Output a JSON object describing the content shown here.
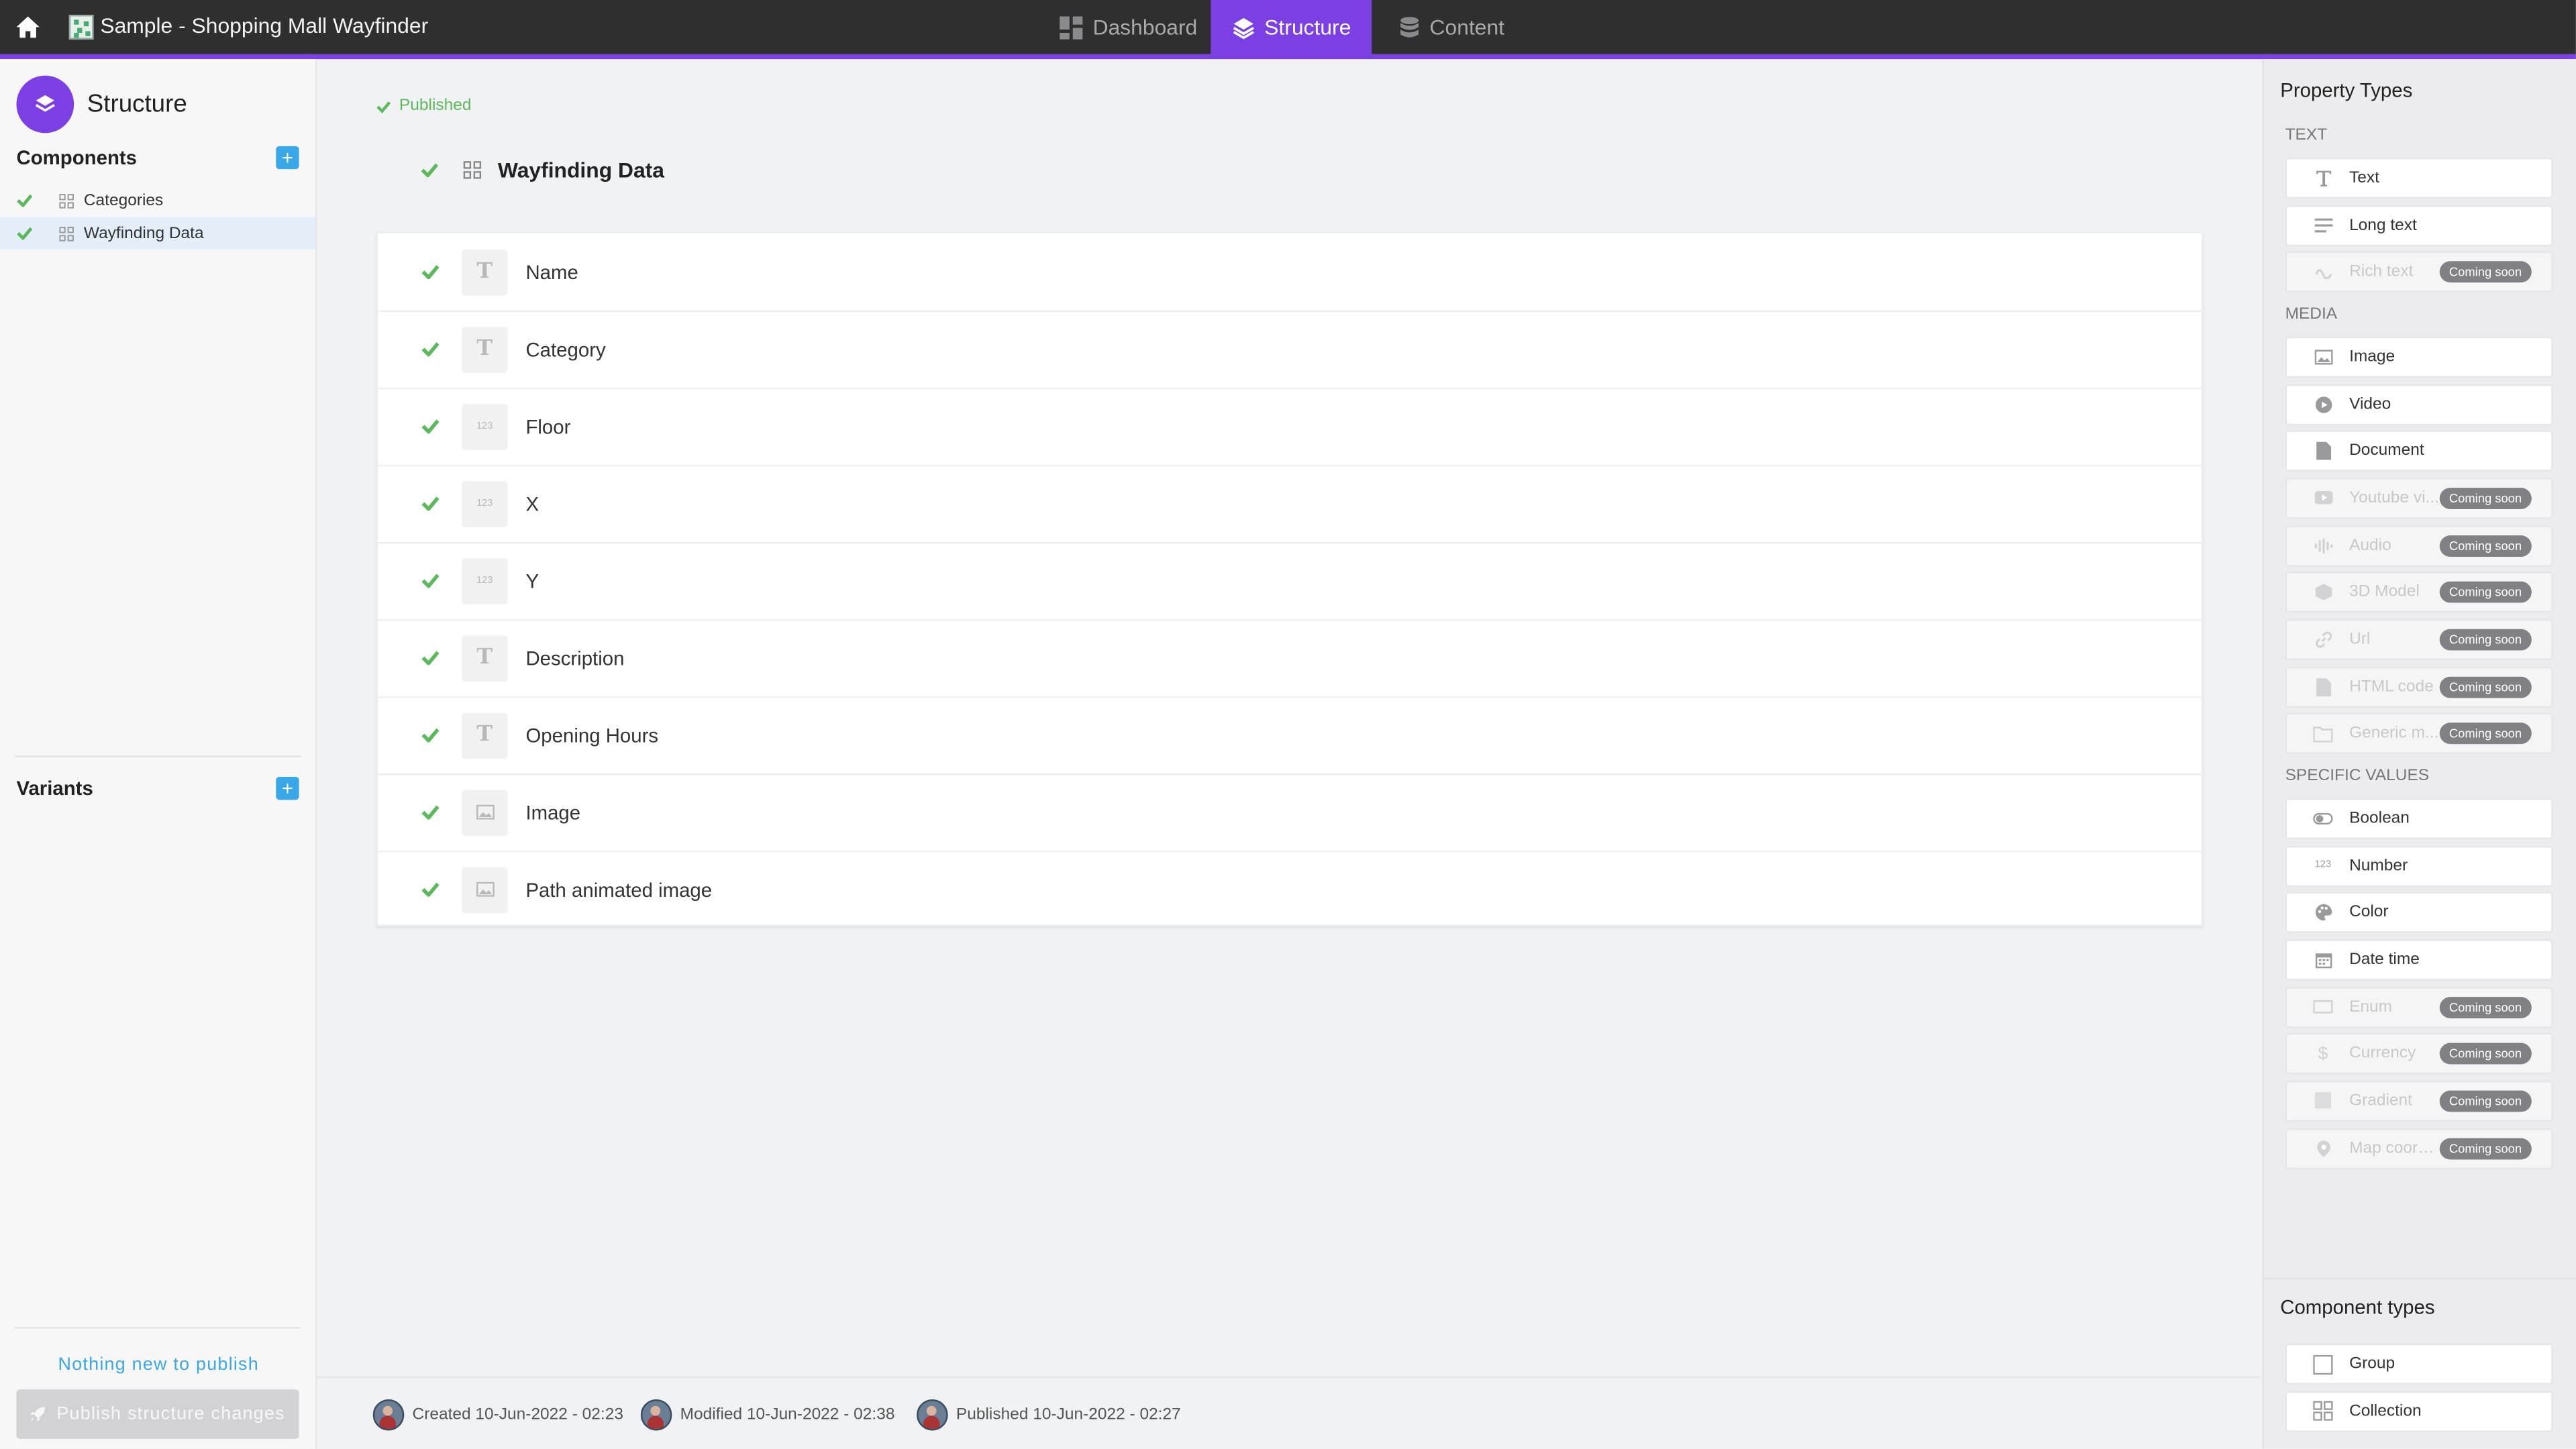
{
  "app": {
    "title": "Sample - Shopping Mall Wayfinder"
  },
  "nav": {
    "tabs": [
      {
        "label": "Dashboard",
        "icon": "dashboard-icon",
        "active": false
      },
      {
        "label": "Structure",
        "icon": "layers-icon",
        "active": true
      },
      {
        "label": "Content",
        "icon": "database-icon",
        "active": false
      }
    ]
  },
  "sidebar": {
    "title": "Structure",
    "components_label": "Components",
    "components": [
      {
        "label": "Categories",
        "selected": false
      },
      {
        "label": "Wayfinding Data",
        "selected": true
      }
    ],
    "variants_label": "Variants",
    "nothing_new": "Nothing new to publish",
    "publish_button": "Publish structure changes"
  },
  "main": {
    "status": "Published",
    "component_name": "Wayfinding Data",
    "fields": [
      {
        "name": "Name",
        "type": "text"
      },
      {
        "name": "Category",
        "type": "text"
      },
      {
        "name": "Floor",
        "type": "number"
      },
      {
        "name": "X",
        "type": "number"
      },
      {
        "name": "Y",
        "type": "number"
      },
      {
        "name": "Description",
        "type": "text"
      },
      {
        "name": "Opening Hours",
        "type": "text"
      },
      {
        "name": "Image",
        "type": "image"
      },
      {
        "name": "Path animated image",
        "type": "image"
      }
    ],
    "type_glyphs": {
      "text": "T",
      "number": "123"
    }
  },
  "footer": {
    "created": "Created 10-Jun-2022 - 02:23",
    "modified": "Modified 10-Jun-2022 - 02:38",
    "published": "Published 10-Jun-2022 - 02:27"
  },
  "right_panel": {
    "title": "Property Types",
    "coming_soon": "Coming soon",
    "sections": {
      "text": "TEXT",
      "media": "MEDIA",
      "specific": "SPECIFIC VALUES"
    },
    "text_types": [
      {
        "label": "Text",
        "icon": "text-icon",
        "soon": false
      },
      {
        "label": "Long text",
        "icon": "long-text-icon",
        "soon": false
      },
      {
        "label": "Rich text",
        "icon": "rich-text-icon",
        "soon": true
      }
    ],
    "media_types": [
      {
        "label": "Image",
        "icon": "image-icon",
        "soon": false
      },
      {
        "label": "Video",
        "icon": "video-icon",
        "soon": false
      },
      {
        "label": "Document",
        "icon": "document-icon",
        "soon": false
      },
      {
        "label": "Youtube vi...",
        "icon": "youtube-icon",
        "soon": true
      },
      {
        "label": "Audio",
        "icon": "audio-icon",
        "soon": true
      },
      {
        "label": "3D Model",
        "icon": "cube-icon",
        "soon": true
      },
      {
        "label": "Url",
        "icon": "link-icon",
        "soon": true
      },
      {
        "label": "HTML code",
        "icon": "code-icon",
        "soon": true
      },
      {
        "label": "Generic m...",
        "icon": "folder-icon",
        "soon": true
      }
    ],
    "specific_types": [
      {
        "label": "Boolean",
        "icon": "toggle-icon",
        "soon": false
      },
      {
        "label": "Number",
        "icon": "number-icon",
        "soon": false
      },
      {
        "label": "Color",
        "icon": "palette-icon",
        "soon": false
      },
      {
        "label": "Date time",
        "icon": "calendar-icon",
        "soon": false
      },
      {
        "label": "Enum",
        "icon": "list-icon",
        "soon": true
      },
      {
        "label": "Currency",
        "icon": "dollar-icon",
        "soon": true
      },
      {
        "label": "Gradient",
        "icon": "gradient-icon",
        "soon": true
      },
      {
        "label": "Map coord...",
        "icon": "map-pin-icon",
        "soon": true
      }
    ],
    "component_types_title": "Component types",
    "component_types": [
      {
        "label": "Group",
        "icon": "group-icon"
      },
      {
        "label": "Collection",
        "icon": "collection-icon"
      }
    ]
  },
  "colors": {
    "accent": "#7b3fe4",
    "success": "#5cb85c",
    "info": "#3aa8e6",
    "topbar": "#2f2f30"
  }
}
